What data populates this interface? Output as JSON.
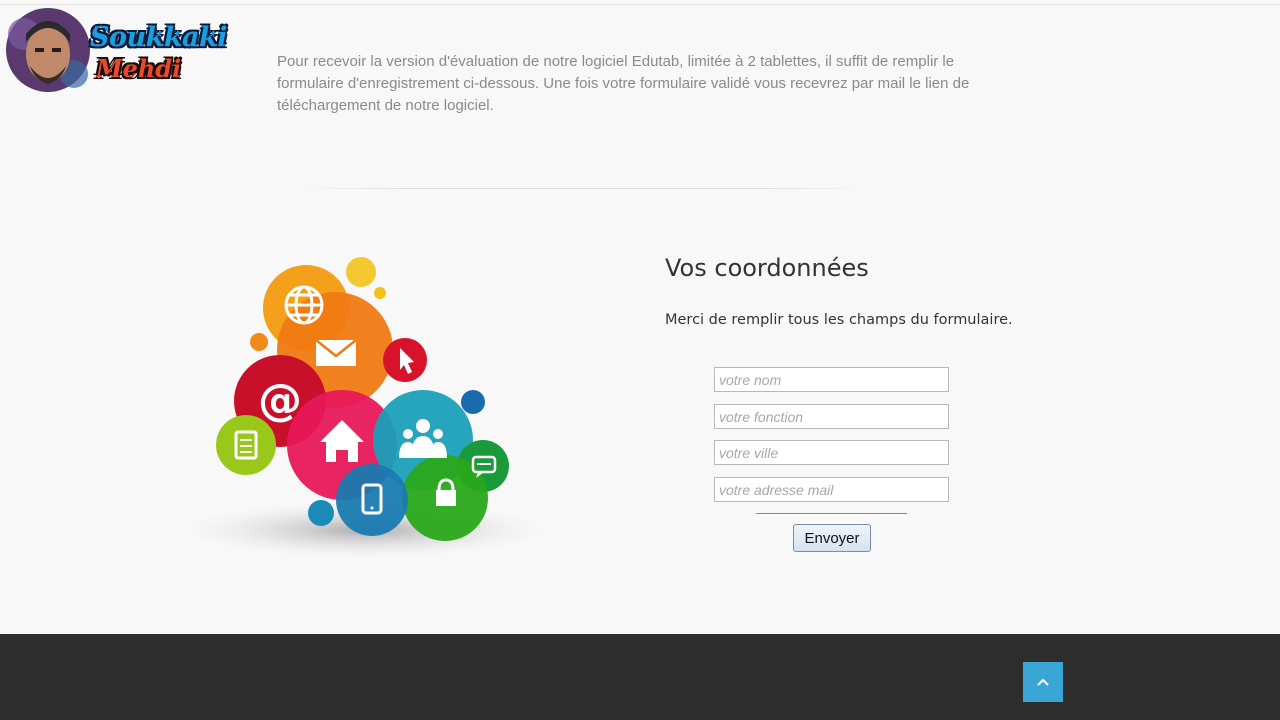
{
  "logo": {
    "line1": "Soukkaki",
    "line2": "Mehdi"
  },
  "intro": {
    "text": "Pour recevoir la version d'évaluation de notre logiciel Edutab, limitée à 2 tablettes, il suffit de remplir le formulaire d'enregistrement ci-dessous. Une fois votre formulaire validé vous recevrez par mail le lien de téléchargement de notre logiciel."
  },
  "form": {
    "title": "Vos coordonnées",
    "subtitle": "Merci de remplir tous les champs du formulaire.",
    "fields": [
      {
        "placeholder": "votre nom",
        "value": ""
      },
      {
        "placeholder": "votre fonction",
        "value": ""
      },
      {
        "placeholder": "votre ville",
        "value": ""
      },
      {
        "placeholder": "votre adresse mail",
        "value": ""
      }
    ],
    "submit_label": "Envoyer"
  },
  "illustration": {
    "icons": [
      "globe-icon",
      "envelope-icon",
      "cursor-icon",
      "at-sign-icon",
      "document-icon",
      "home-icon",
      "people-icon",
      "smartphone-icon",
      "lock-icon",
      "chat-icon"
    ]
  },
  "footer": {
    "to_top_icon": "chevron-up-icon"
  },
  "colors": {
    "accent": "#3aa6d6",
    "footer_bg": "#2d2d2d"
  }
}
